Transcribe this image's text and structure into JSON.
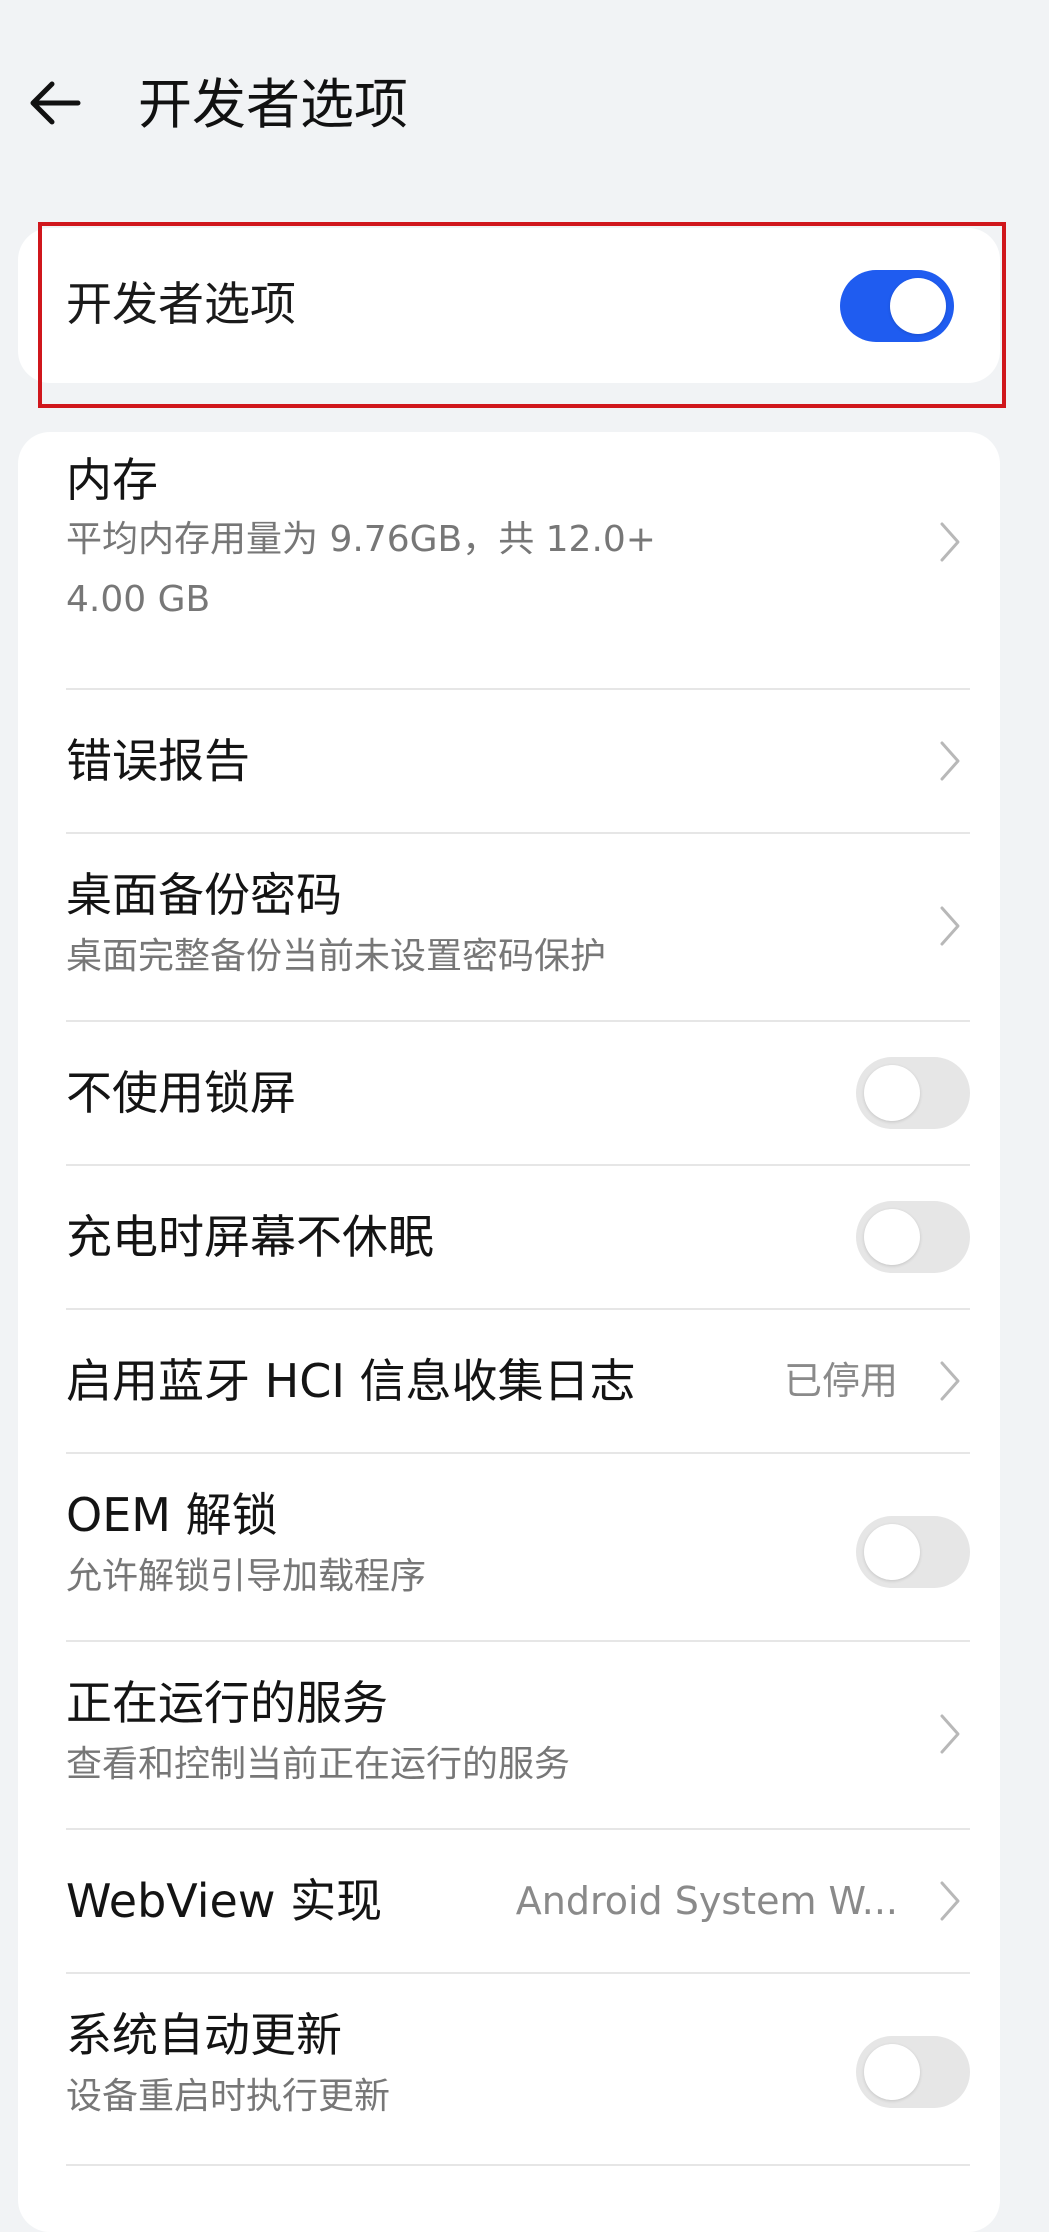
{
  "header": {
    "title": "开发者选项"
  },
  "master": {
    "label": "开发者选项",
    "enabled": true
  },
  "colors": {
    "accent": "#1f5cf0",
    "highlight": "#d0161c"
  },
  "items": [
    {
      "title": "内存",
      "subtitle_line1": "平均内存用量为 9.76GB，共 12.0+",
      "subtitle_line2": "4.00 GB",
      "control": "chevron"
    },
    {
      "title": "错误报告",
      "control": "chevron"
    },
    {
      "title": "桌面备份密码",
      "subtitle": "桌面完整备份当前未设置密码保护",
      "control": "chevron"
    },
    {
      "title": "不使用锁屏",
      "control": "toggle",
      "enabled": false
    },
    {
      "title": "充电时屏幕不休眠",
      "control": "toggle",
      "enabled": false
    },
    {
      "title": "启用蓝牙 HCI 信息收集日志",
      "value": "已停用",
      "control": "chevron"
    },
    {
      "title": "OEM 解锁",
      "subtitle": "允许解锁引导加载程序",
      "control": "toggle",
      "enabled": false
    },
    {
      "title": "正在运行的服务",
      "subtitle": "查看和控制当前正在运行的服务",
      "control": "chevron"
    },
    {
      "title": "WebView 实现",
      "value": "Android System W...",
      "control": "chevron"
    },
    {
      "title": "系统自动更新",
      "subtitle": "设备重启时执行更新",
      "control": "toggle",
      "enabled": false
    }
  ]
}
